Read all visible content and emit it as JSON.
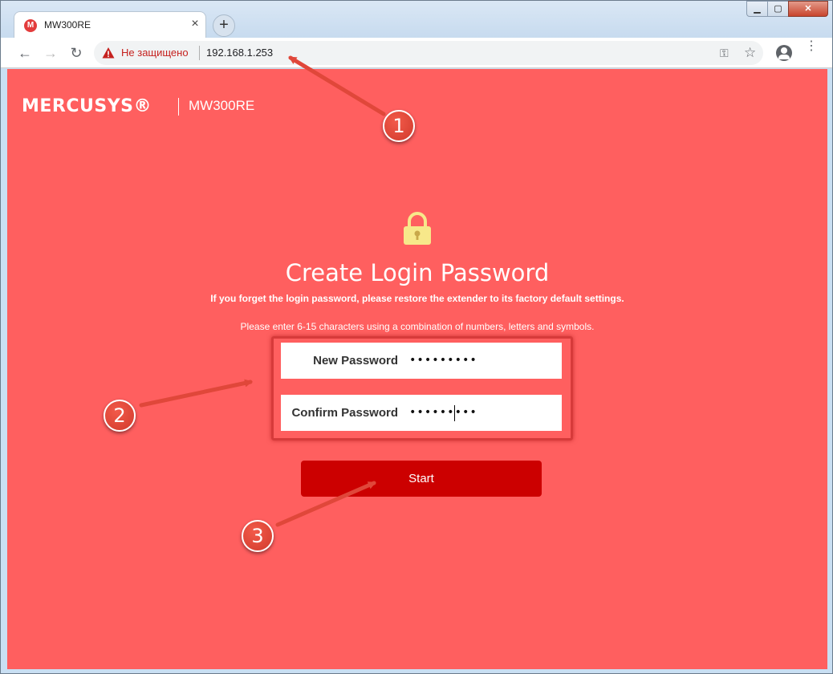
{
  "browser": {
    "tab_title": "MW300RE",
    "favicon_letter": "M",
    "tab_close": "×",
    "newtab": "+",
    "win_min": "▁",
    "win_max": "▢",
    "win_close": "✕",
    "back": "←",
    "forward": "→",
    "reload": "↻",
    "insecure_text": "Не защищено",
    "url": "192.168.1.253",
    "key": "⚿",
    "star": "☆",
    "menu": "⋮"
  },
  "page": {
    "brand": "MERCUSYS®",
    "model": "MW300RE",
    "title": "Create Login Password",
    "subtitle": "If you forget the login password, please restore the extender to its factory default settings.",
    "hint": "Please enter 6-15 characters using a combination of numbers, letters and symbols.",
    "new_password_label": "New Password",
    "new_password_value": "•••••••••",
    "confirm_password_label": "Confirm Password",
    "confirm_password_value": "•••••••••",
    "start_label": "Start"
  },
  "annotations": {
    "badge1": "1",
    "badge2": "2",
    "badge3": "3"
  },
  "colors": {
    "page_bg": "#ff5f5f",
    "button": "#cc0000",
    "annotation": "#e0473a"
  }
}
